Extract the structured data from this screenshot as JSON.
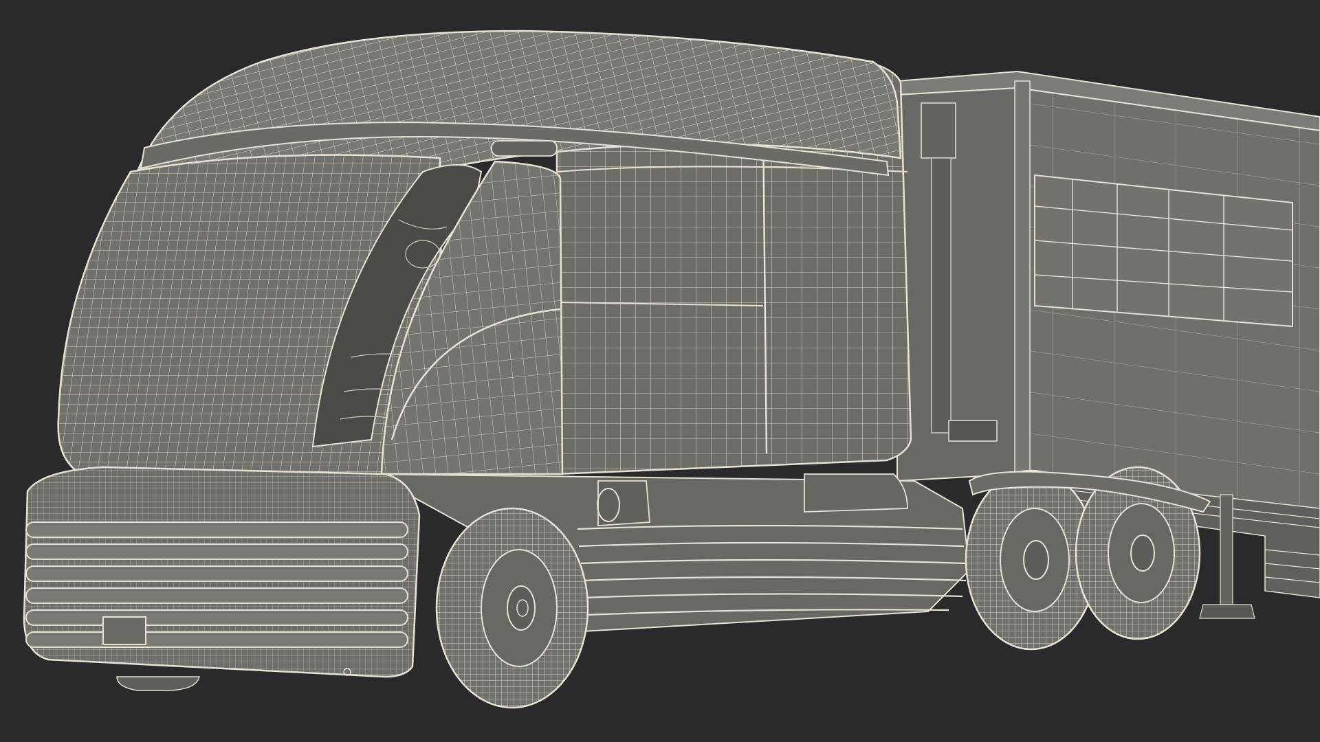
{
  "scene": {
    "subject": "wireframe-render-truck",
    "colors": {
      "background": "#2a2a2a",
      "surface": "#6e6f69",
      "surface_dark": "#5c5d58",
      "surface_light": "#7b7c75",
      "wire": "#e6e3d6",
      "wire_dim": "#c9c6b9",
      "shadow": "#3f403c"
    }
  }
}
